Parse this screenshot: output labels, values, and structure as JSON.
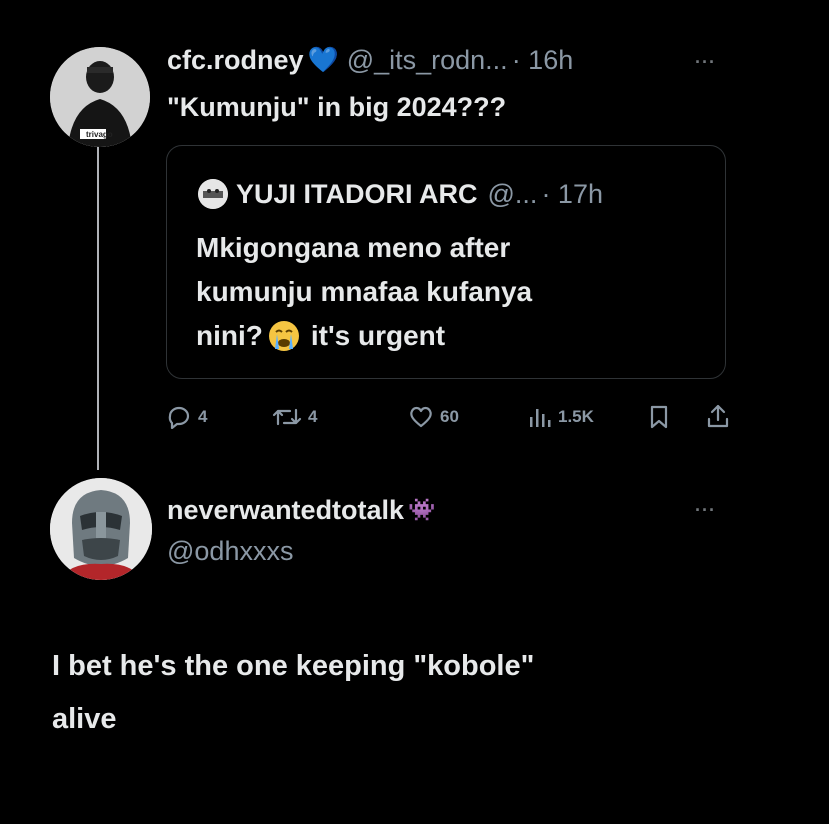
{
  "tweet1": {
    "display_name": "cfc.rodney",
    "heart_emoji": "💙",
    "handle": "@_its_rodn...",
    "time": "· 16h",
    "text": "\"Kumunju\" in big 2024???",
    "avatar_label": "trivago"
  },
  "quoted": {
    "display_name": "YUJI ITADORI ARC",
    "handle": "@...",
    "time": "· 17h",
    "lines": [
      "Mkigongana meno after",
      "kumunju mnafaa kufanya",
      "nini?"
    ],
    "tail": "it's urgent"
  },
  "actions": {
    "replies": "4",
    "reposts": "4",
    "likes": "60",
    "views": "1.5K"
  },
  "reply": {
    "display_name": "neverwantedtotalk",
    "badge_emoji": "👾",
    "handle": "@odhxxxs",
    "text_line1": "I bet he's the one keeping \"kobole\"",
    "text_line2": "alive"
  },
  "menu_label": "···",
  "colors": {
    "background": "#000000",
    "text": "#e7e9ea",
    "muted": "#8b98a5",
    "border": "#2f3336",
    "heart_blue": "#4ba3f5",
    "alien_purple": "#8e5bd6"
  }
}
